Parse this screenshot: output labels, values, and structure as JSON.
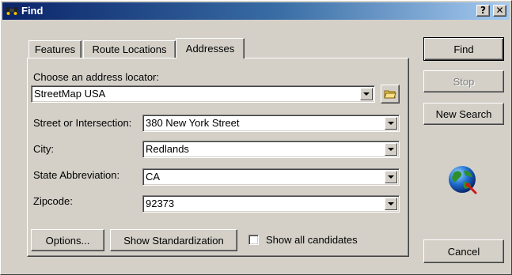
{
  "window": {
    "title": "Find",
    "help_label": "?",
    "close_label": "✕"
  },
  "tabs": [
    {
      "label": "Features"
    },
    {
      "label": "Route Locations"
    },
    {
      "label": "Addresses"
    }
  ],
  "active_tab": "Addresses",
  "locator": {
    "label": "Choose an address locator:",
    "value": "StreetMap USA",
    "browse_icon": "folder-icon"
  },
  "fields": [
    {
      "label": "Street or Intersection:",
      "value": "380 New York Street"
    },
    {
      "label": "City:",
      "value": "Redlands"
    },
    {
      "label": "State Abbreviation:",
      "value": "CA"
    },
    {
      "label": "Zipcode:",
      "value": "92373"
    }
  ],
  "bottom": {
    "options_label": "Options...",
    "standardization_label": "Show Standardization",
    "checkbox_label": "Show all candidates",
    "checkbox_checked": false
  },
  "side_buttons": {
    "find_label": "Find",
    "stop_label": "Stop",
    "new_search_label": "New Search",
    "cancel_label": "Cancel"
  },
  "icons": {
    "title_icon": "binoculars-icon",
    "globe_icon": "globe-icon"
  },
  "colors": {
    "dialog_bg": "#d4d0c8",
    "titlebar_start": "#0a246a",
    "titlebar_end": "#a6caf0"
  }
}
